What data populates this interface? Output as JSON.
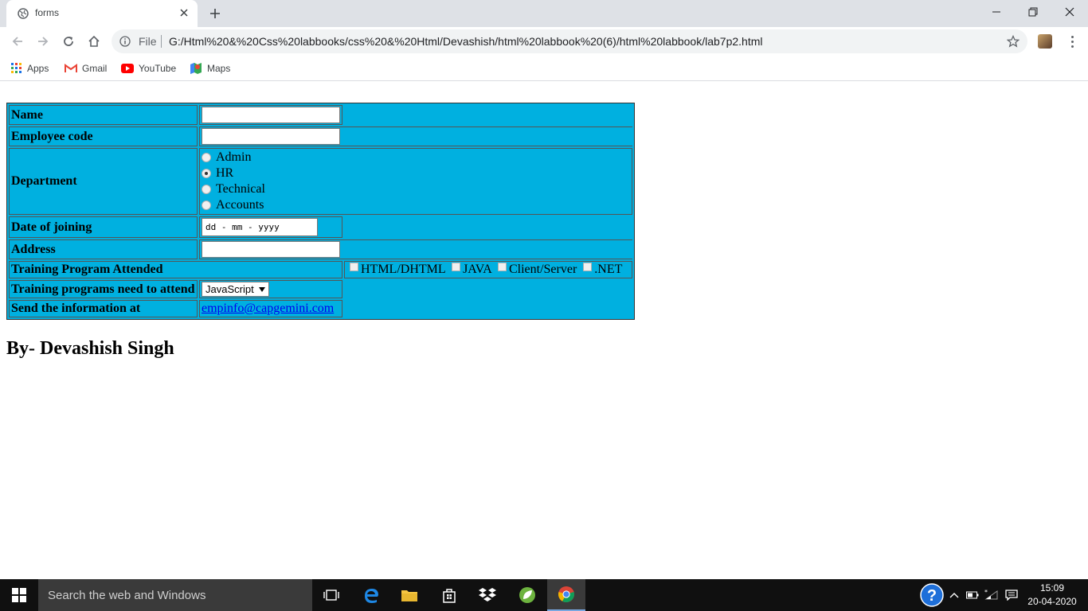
{
  "browser": {
    "tab_title": "forms",
    "file_label": "File",
    "url": "G:/Html%20&%20Css%20labbooks/css%20&%20Html/Devashish/html%20labbook%20(6)/html%20labbook/lab7p2.html",
    "bookmarks": [
      {
        "label": "Apps",
        "icon": "apps-grid-icon"
      },
      {
        "label": "Gmail",
        "icon": "gmail-icon"
      },
      {
        "label": "YouTube",
        "icon": "youtube-icon"
      },
      {
        "label": "Maps",
        "icon": "maps-icon"
      }
    ]
  },
  "form": {
    "name_label": "Name",
    "name_value": "",
    "employee_code_label": "Employee code",
    "employee_code_value": "",
    "department_label": "Department",
    "departments": [
      {
        "label": "Admin",
        "selected": false
      },
      {
        "label": "HR",
        "selected": true
      },
      {
        "label": "Technical",
        "selected": false
      },
      {
        "label": "Accounts",
        "selected": false
      }
    ],
    "date_label": "Date of joining",
    "date_placeholder": "dd - mm - yyyy",
    "address_label": "Address",
    "address_value": "",
    "training_attended_label": "Training Program Attended",
    "training_options": [
      {
        "label": "HTML/DHTML",
        "checked": false
      },
      {
        "label": "JAVA",
        "checked": false
      },
      {
        "label": "Client/Server",
        "checked": false
      },
      {
        "label": ".NET",
        "checked": false
      }
    ],
    "training_need_label": "Training programs need to attend",
    "training_need_selected": "JavaScript",
    "send_info_label": "Send the information at",
    "email": "empinfo@capgemini.com"
  },
  "byline": "By- Devashish Singh",
  "taskbar": {
    "search_placeholder": "Search the web and Windows",
    "time": "15:09",
    "date": "20-04-2020"
  },
  "colors": {
    "form_background": "#00b0e0",
    "link": "#0000ee",
    "taskbar": "#101010"
  }
}
